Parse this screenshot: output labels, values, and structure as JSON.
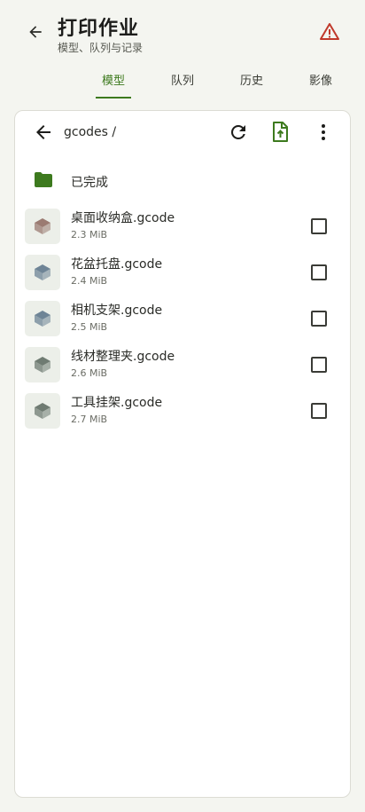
{
  "header": {
    "title": "打印作业",
    "subtitle": "模型、队列与记录"
  },
  "tabs": [
    {
      "label": "模型",
      "active": true
    },
    {
      "label": "队列",
      "active": false
    },
    {
      "label": "历史",
      "active": false
    },
    {
      "label": "影像",
      "active": false
    }
  ],
  "browser": {
    "path": "gcodes /",
    "folder": {
      "label": "已完成"
    },
    "files": [
      {
        "name": "桌面收纳盒.gcode",
        "size": "2.3 MiB",
        "color": "#9b7b72",
        "checked": false
      },
      {
        "name": "花盆托盘.gcode",
        "size": "2.4 MiB",
        "color": "#6e8496",
        "checked": false
      },
      {
        "name": "相机支架.gcode",
        "size": "2.5 MiB",
        "color": "#6e8496",
        "checked": false
      },
      {
        "name": "线材整理夹.gcode",
        "size": "2.6 MiB",
        "color": "#6f7b72",
        "checked": false
      },
      {
        "name": "工具挂架.gcode",
        "size": "2.7 MiB",
        "color": "#6f7b72",
        "checked": false
      }
    ]
  },
  "colors": {
    "accent": "#3d7a1e",
    "warning": "#c0392b",
    "background": "#f4f5f0"
  }
}
